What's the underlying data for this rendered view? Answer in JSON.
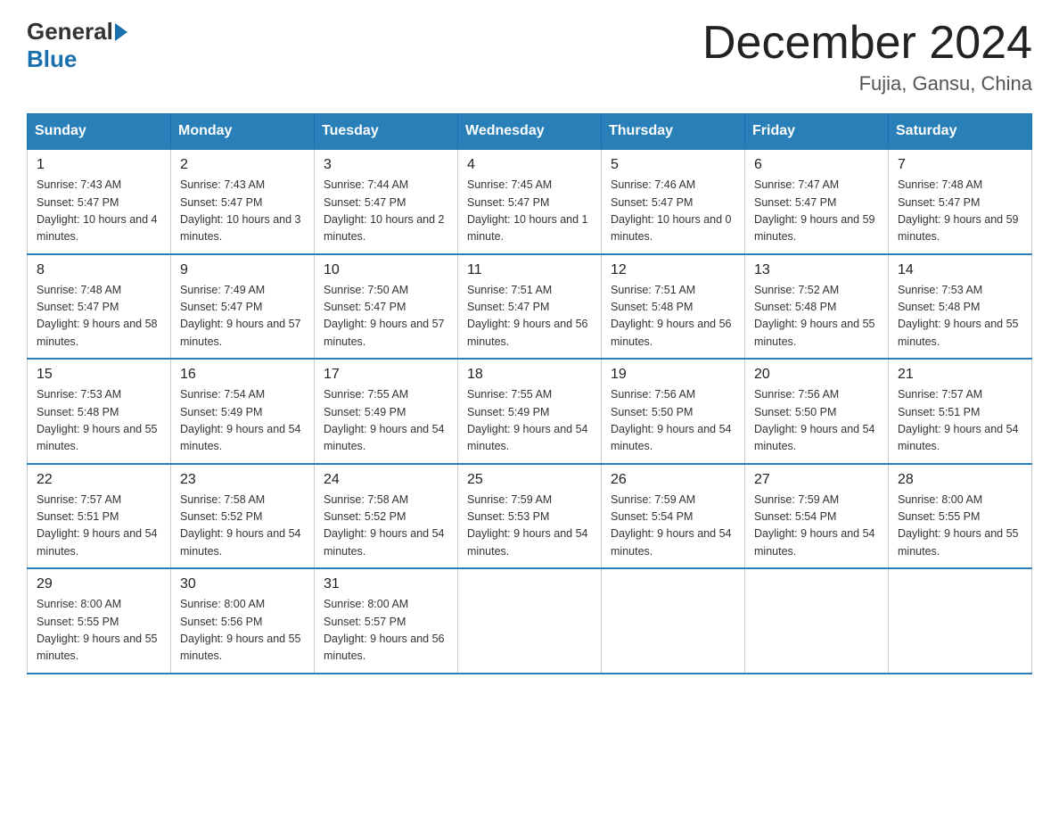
{
  "header": {
    "logo_general": "General",
    "logo_blue": "Blue",
    "month_title": "December 2024",
    "location": "Fujia, Gansu, China"
  },
  "days_of_week": [
    "Sunday",
    "Monday",
    "Tuesday",
    "Wednesday",
    "Thursday",
    "Friday",
    "Saturday"
  ],
  "weeks": [
    [
      {
        "day": "1",
        "sunrise": "7:43 AM",
        "sunset": "5:47 PM",
        "daylight": "10 hours and 4 minutes."
      },
      {
        "day": "2",
        "sunrise": "7:43 AM",
        "sunset": "5:47 PM",
        "daylight": "10 hours and 3 minutes."
      },
      {
        "day": "3",
        "sunrise": "7:44 AM",
        "sunset": "5:47 PM",
        "daylight": "10 hours and 2 minutes."
      },
      {
        "day": "4",
        "sunrise": "7:45 AM",
        "sunset": "5:47 PM",
        "daylight": "10 hours and 1 minute."
      },
      {
        "day": "5",
        "sunrise": "7:46 AM",
        "sunset": "5:47 PM",
        "daylight": "10 hours and 0 minutes."
      },
      {
        "day": "6",
        "sunrise": "7:47 AM",
        "sunset": "5:47 PM",
        "daylight": "9 hours and 59 minutes."
      },
      {
        "day": "7",
        "sunrise": "7:48 AM",
        "sunset": "5:47 PM",
        "daylight": "9 hours and 59 minutes."
      }
    ],
    [
      {
        "day": "8",
        "sunrise": "7:48 AM",
        "sunset": "5:47 PM",
        "daylight": "9 hours and 58 minutes."
      },
      {
        "day": "9",
        "sunrise": "7:49 AM",
        "sunset": "5:47 PM",
        "daylight": "9 hours and 57 minutes."
      },
      {
        "day": "10",
        "sunrise": "7:50 AM",
        "sunset": "5:47 PM",
        "daylight": "9 hours and 57 minutes."
      },
      {
        "day": "11",
        "sunrise": "7:51 AM",
        "sunset": "5:47 PM",
        "daylight": "9 hours and 56 minutes."
      },
      {
        "day": "12",
        "sunrise": "7:51 AM",
        "sunset": "5:48 PM",
        "daylight": "9 hours and 56 minutes."
      },
      {
        "day": "13",
        "sunrise": "7:52 AM",
        "sunset": "5:48 PM",
        "daylight": "9 hours and 55 minutes."
      },
      {
        "day": "14",
        "sunrise": "7:53 AM",
        "sunset": "5:48 PM",
        "daylight": "9 hours and 55 minutes."
      }
    ],
    [
      {
        "day": "15",
        "sunrise": "7:53 AM",
        "sunset": "5:48 PM",
        "daylight": "9 hours and 55 minutes."
      },
      {
        "day": "16",
        "sunrise": "7:54 AM",
        "sunset": "5:49 PM",
        "daylight": "9 hours and 54 minutes."
      },
      {
        "day": "17",
        "sunrise": "7:55 AM",
        "sunset": "5:49 PM",
        "daylight": "9 hours and 54 minutes."
      },
      {
        "day": "18",
        "sunrise": "7:55 AM",
        "sunset": "5:49 PM",
        "daylight": "9 hours and 54 minutes."
      },
      {
        "day": "19",
        "sunrise": "7:56 AM",
        "sunset": "5:50 PM",
        "daylight": "9 hours and 54 minutes."
      },
      {
        "day": "20",
        "sunrise": "7:56 AM",
        "sunset": "5:50 PM",
        "daylight": "9 hours and 54 minutes."
      },
      {
        "day": "21",
        "sunrise": "7:57 AM",
        "sunset": "5:51 PM",
        "daylight": "9 hours and 54 minutes."
      }
    ],
    [
      {
        "day": "22",
        "sunrise": "7:57 AM",
        "sunset": "5:51 PM",
        "daylight": "9 hours and 54 minutes."
      },
      {
        "day": "23",
        "sunrise": "7:58 AM",
        "sunset": "5:52 PM",
        "daylight": "9 hours and 54 minutes."
      },
      {
        "day": "24",
        "sunrise": "7:58 AM",
        "sunset": "5:52 PM",
        "daylight": "9 hours and 54 minutes."
      },
      {
        "day": "25",
        "sunrise": "7:59 AM",
        "sunset": "5:53 PM",
        "daylight": "9 hours and 54 minutes."
      },
      {
        "day": "26",
        "sunrise": "7:59 AM",
        "sunset": "5:54 PM",
        "daylight": "9 hours and 54 minutes."
      },
      {
        "day": "27",
        "sunrise": "7:59 AM",
        "sunset": "5:54 PM",
        "daylight": "9 hours and 54 minutes."
      },
      {
        "day": "28",
        "sunrise": "8:00 AM",
        "sunset": "5:55 PM",
        "daylight": "9 hours and 55 minutes."
      }
    ],
    [
      {
        "day": "29",
        "sunrise": "8:00 AM",
        "sunset": "5:55 PM",
        "daylight": "9 hours and 55 minutes."
      },
      {
        "day": "30",
        "sunrise": "8:00 AM",
        "sunset": "5:56 PM",
        "daylight": "9 hours and 55 minutes."
      },
      {
        "day": "31",
        "sunrise": "8:00 AM",
        "sunset": "5:57 PM",
        "daylight": "9 hours and 56 minutes."
      },
      null,
      null,
      null,
      null
    ]
  ],
  "labels": {
    "sunrise": "Sunrise:",
    "sunset": "Sunset:",
    "daylight": "Daylight:"
  }
}
